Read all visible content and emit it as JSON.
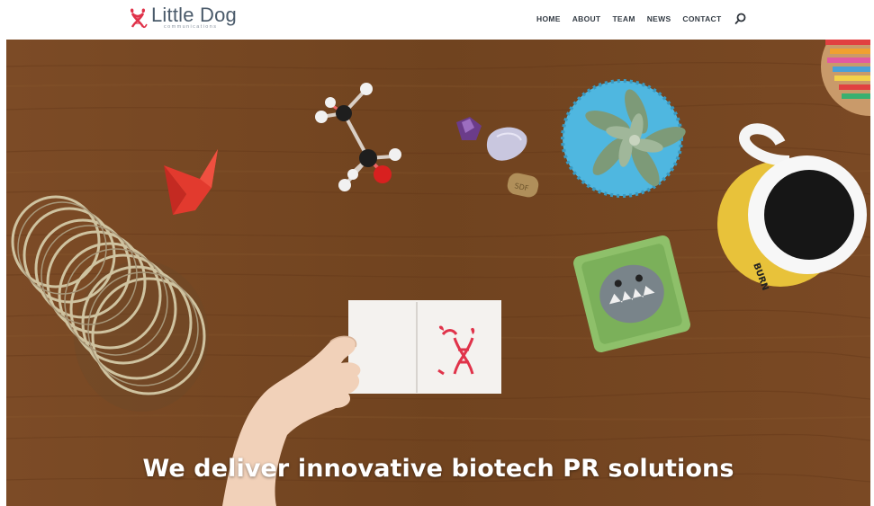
{
  "header": {
    "logo": {
      "name": "Little Dog",
      "subtitle": "communications"
    },
    "nav": [
      {
        "label": "HOME"
      },
      {
        "label": "ABOUT"
      },
      {
        "label": "TEAM"
      },
      {
        "label": "NEWS"
      },
      {
        "label": "CONTACT"
      }
    ],
    "search_icon": "search-icon"
  },
  "hero": {
    "headline": "We deliver innovative biotech PR solutions"
  },
  "colors": {
    "brand_red": "#e0334a",
    "nav_text": "#333b44",
    "logo_text": "#4a5a6a",
    "wood": "#74461f"
  }
}
